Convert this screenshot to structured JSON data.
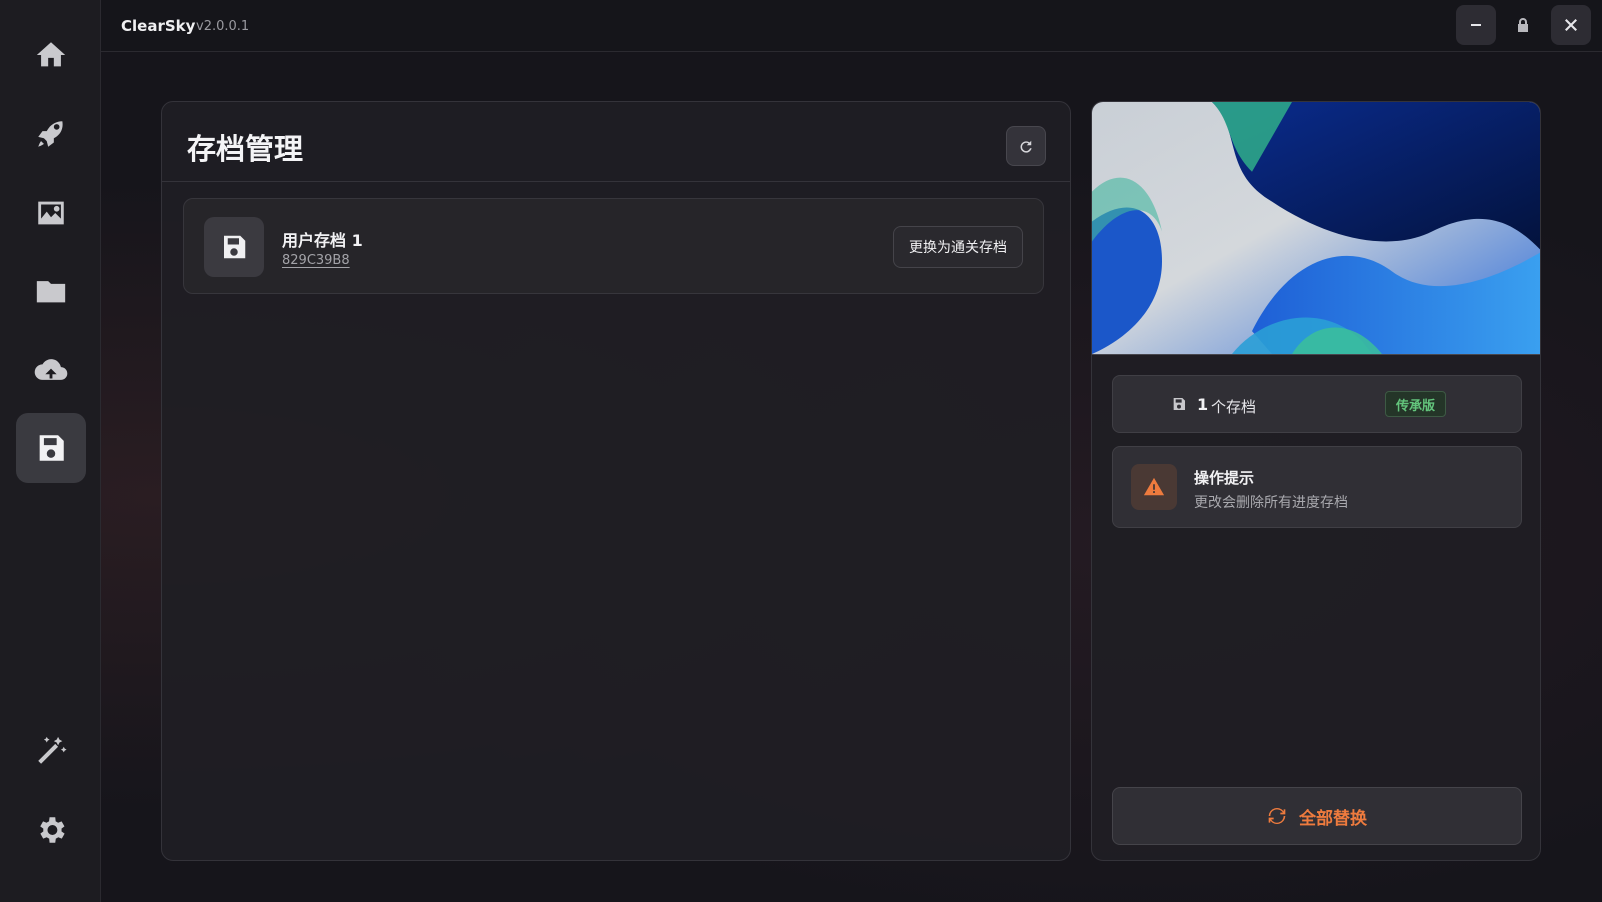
{
  "app": {
    "name": "ClearSky",
    "version": "v2.0.0.1"
  },
  "sidebar": {
    "items": [
      {
        "icon": "home-icon"
      },
      {
        "icon": "rocket-icon"
      },
      {
        "icon": "image-icon"
      },
      {
        "icon": "folder-icon"
      },
      {
        "icon": "cloud-upload-icon"
      },
      {
        "icon": "save-icon",
        "active": true
      },
      {
        "icon": "magic-wand-icon"
      },
      {
        "icon": "gear-icon"
      }
    ]
  },
  "window_controls": [
    "minimize-icon",
    "lock-icon",
    "close-icon"
  ],
  "main": {
    "title": "存档管理",
    "saves": [
      {
        "name": "用户存档 1",
        "id": "829C39B8",
        "action_label": "更换为通关存档"
      }
    ]
  },
  "side": {
    "count_number": "1",
    "count_label": "个存档",
    "edition": "传承版",
    "tip_title": "操作提示",
    "tip_text": "更改会删除所有进度存档",
    "replace_all_label": "全部替换"
  },
  "colors": {
    "accent_orange": "#ee7b3e",
    "edition_green": "#63c47c",
    "active_nav": "#3a3a40"
  }
}
